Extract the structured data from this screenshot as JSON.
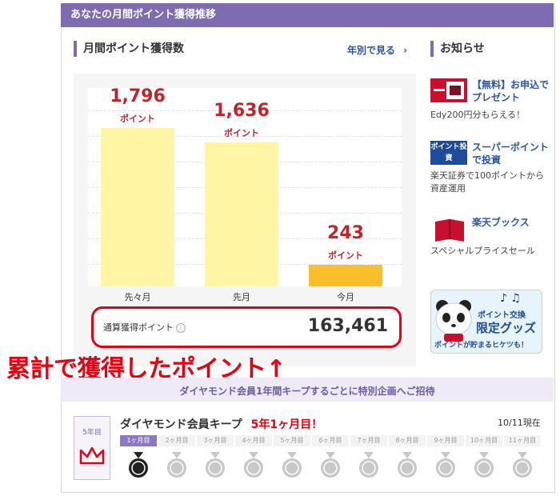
{
  "header": {
    "title": "あなたの月間ポイント獲得推移"
  },
  "monthly": {
    "section_title": "月間ポイント獲得数",
    "yearly_link": "年別で見る",
    "unit": "ポイント",
    "total_label": "通算獲得ポイント",
    "total_value": "163,461"
  },
  "chart_data": {
    "type": "bar",
    "categories": [
      "先々月",
      "先月",
      "今月"
    ],
    "values": [
      1796,
      1636,
      243
    ],
    "value_labels": [
      "1,796",
      "1,636",
      "243"
    ],
    "ylim": [
      0,
      2000
    ],
    "colors": [
      "#fff5a5",
      "#fff5a5",
      "#fbbf2c"
    ],
    "grid": true
  },
  "annotation": "累計で獲得したポイント↑",
  "news": {
    "section_title": "お知らせ",
    "items": [
      {
        "head": "【無料】お申込でプレゼント",
        "sub": "Edy200円分もらえる！",
        "icon": "gift-card-icon"
      },
      {
        "head": "スーパーポイントで投資",
        "sub": "楽天証券で100ポイントから資産運用",
        "badge": "ポイント投資"
      },
      {
        "head": "楽天ブックス",
        "sub": "スペシャルプライスセール",
        "icon": "book-icon"
      }
    ],
    "promo": {
      "line1": "ポイント交換",
      "line2": "限定グッズ",
      "line3": "ポイントが貯まるヒケツも！"
    }
  },
  "diamond": {
    "banner": "ダイヤモンド会員1年間キープするごとに特別企画へご招待",
    "years": "5年目",
    "title": "ダイヤモンド会員キープ",
    "highlight": "5年1ヶ月目！",
    "date": "10/11現在",
    "steps": [
      "1ヶ月目",
      "2ヶ月目",
      "3ヶ月目",
      "4ヶ月目",
      "5ヶ月目",
      "6ヶ月目",
      "7ヶ月目",
      "8ヶ月目",
      "9ヶ月目",
      "10ヶ月目",
      "11ヶ月目"
    ],
    "current_step": 1,
    "accent": "#7e6bb0"
  }
}
